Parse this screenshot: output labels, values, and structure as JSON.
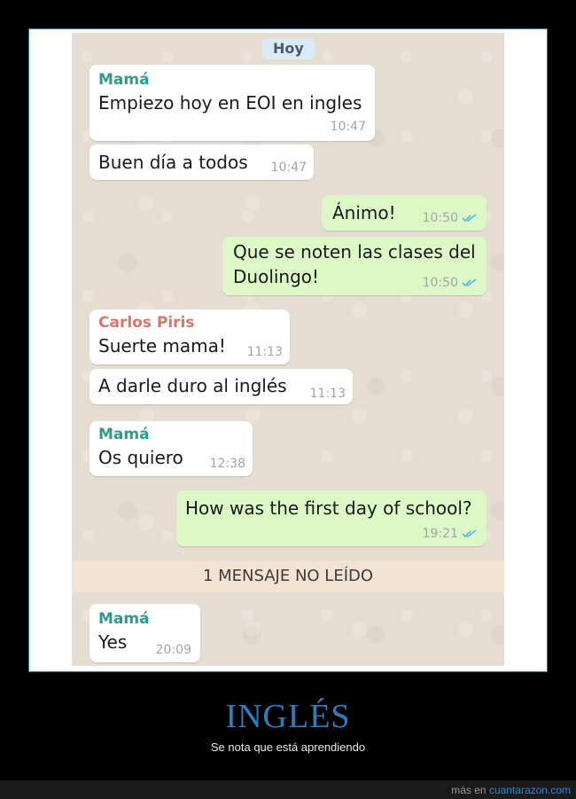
{
  "chat": {
    "date_label": "Hoy",
    "messages": [
      {
        "sender": "Mamá",
        "text": "Empiezo hoy en EOI en ingles",
        "time": "10:47"
      },
      {
        "text": "Buen día a todos",
        "time": "10:47"
      },
      {
        "text": "Ánimo!",
        "time": "10:50"
      },
      {
        "text": "Que se noten las clases del",
        "text2": "Duolingo!",
        "time": "10:50"
      },
      {
        "sender": "Carlos Piris",
        "text": "Suerte mama!",
        "time": "11:13"
      },
      {
        "text": "A darle duro al inglés",
        "time": "11:13"
      },
      {
        "sender": "Mamá",
        "text": "Os quiero",
        "time": "12:38"
      },
      {
        "text": "How was the first day of school?",
        "time": "19:21"
      },
      {
        "sender": "Mamá",
        "text": "Yes",
        "time": "20:09"
      }
    ],
    "unread_label": "1 MENSAJE NO LEÍDO"
  },
  "caption": {
    "title": "INGLÉS",
    "subtitle": "Se nota que está aprendiendo"
  },
  "footer": {
    "prefix": "más en ",
    "link": "cuantarazon.com"
  },
  "colors": {
    "incoming_bubble": "#ffffff",
    "outgoing_bubble": "#dcf8c6",
    "read_ticks": "#4fb6ec",
    "title_accent": "#2e7dbd"
  },
  "icons": {
    "read_receipt": "double-check-icon"
  }
}
